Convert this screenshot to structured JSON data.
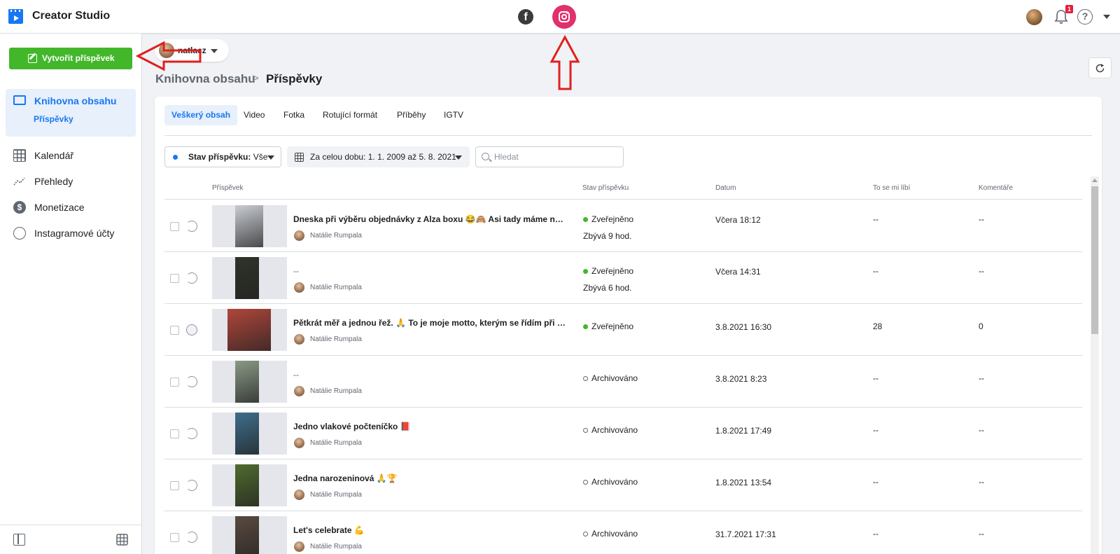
{
  "header": {
    "app_title": "Creator Studio",
    "notification_count": "1",
    "icons": [
      "creator-studio-logo",
      "facebook-icon",
      "instagram-icon",
      "avatar",
      "bell-icon",
      "help-icon",
      "chevron-down-icon"
    ]
  },
  "sidebar": {
    "create_label": "Vytvořit příspěvek",
    "active_section": "Knihovna obsahu",
    "active_sub": "Příspěvky",
    "items": [
      {
        "label": "Kalendář",
        "icon": "calendar-icon"
      },
      {
        "label": "Přehledy",
        "icon": "insights-icon"
      },
      {
        "label": "Monetizace",
        "icon": "dollar-icon"
      },
      {
        "label": "Instagramové účty",
        "icon": "account-settings-icon"
      }
    ]
  },
  "account": {
    "name": "natlacz"
  },
  "breadcrumb": {
    "parent": "Knihovna obsahu",
    "separator": ">",
    "current": "Příspěvky"
  },
  "tabs": [
    "Veškerý obsah",
    "Video",
    "Fotka",
    "Rotující formát",
    "Příběhy",
    "IGTV"
  ],
  "filters": {
    "status_label": "Stav příspěvku:",
    "status_value": "Vše",
    "date_range": "Za celou dobu: 1. 1. 2009 až 5. 8. 2021",
    "search_placeholder": "Hledat"
  },
  "table": {
    "columns": [
      "Příspěvek",
      "Stav příspěvku",
      "Datum",
      "To se mi líbí",
      "Komentáře"
    ],
    "rows": [
      {
        "title": "Dneska při výběru objednávky z Alza boxu 😂🙈 Asi tady máme nějaké ...",
        "author": "Natálie Rumpala",
        "status": "Zveřejněno",
        "status_type": "published",
        "remaining": "Zbývá 9 hod.",
        "date": "Včera 18:12",
        "likes": "--",
        "comments": "--",
        "thumb_color": "#c9cdd2"
      },
      {
        "title": "--",
        "author": "Natálie Rumpala",
        "status": "Zveřejněno",
        "status_type": "published",
        "remaining": "Zbývá 6 hod.",
        "date": "Včera 14:31",
        "likes": "--",
        "comments": "--",
        "thumb_color": "#2f3329"
      },
      {
        "title": "Pětkrát měř a jednou řež. 🙏 To je moje motto, kterým se řídím při každ...",
        "author": "Natálie Rumpala",
        "status": "Zveřejněno",
        "status_type": "published",
        "remaining": "",
        "date": "3.8.2021 16:30",
        "likes": "28",
        "comments": "0",
        "thumb_color": "#b0463a"
      },
      {
        "title": "--",
        "author": "Natálie Rumpala",
        "status": "Archivováno",
        "status_type": "archived",
        "remaining": "",
        "date": "3.8.2021 8:23",
        "likes": "--",
        "comments": "--",
        "thumb_color": "#8a9a86"
      },
      {
        "title": "Jedno vlakové počteníčko 📕",
        "author": "Natálie Rumpala",
        "status": "Archivováno",
        "status_type": "archived",
        "remaining": "",
        "date": "1.8.2021 17:49",
        "likes": "--",
        "comments": "--",
        "thumb_color": "#3e6e8c"
      },
      {
        "title": "Jedna narozeninová 🙏🏆",
        "author": "Natálie Rumpala",
        "status": "Archivováno",
        "status_type": "archived",
        "remaining": "",
        "date": "1.8.2021 13:54",
        "likes": "--",
        "comments": "--",
        "thumb_color": "#4f6b2e"
      },
      {
        "title": "Let's celebrate 💪",
        "author": "Natálie Rumpala",
        "status": "Archivováno",
        "status_type": "archived",
        "remaining": "",
        "date": "31.7.2021 17:31",
        "likes": "--",
        "comments": "--",
        "thumb_color": "#5a4a3f"
      }
    ]
  },
  "colors": {
    "brand_blue": "#1877f2",
    "create_green": "#42b72a",
    "instagram": "#e1306c",
    "annotation_red": "#e0201e"
  }
}
